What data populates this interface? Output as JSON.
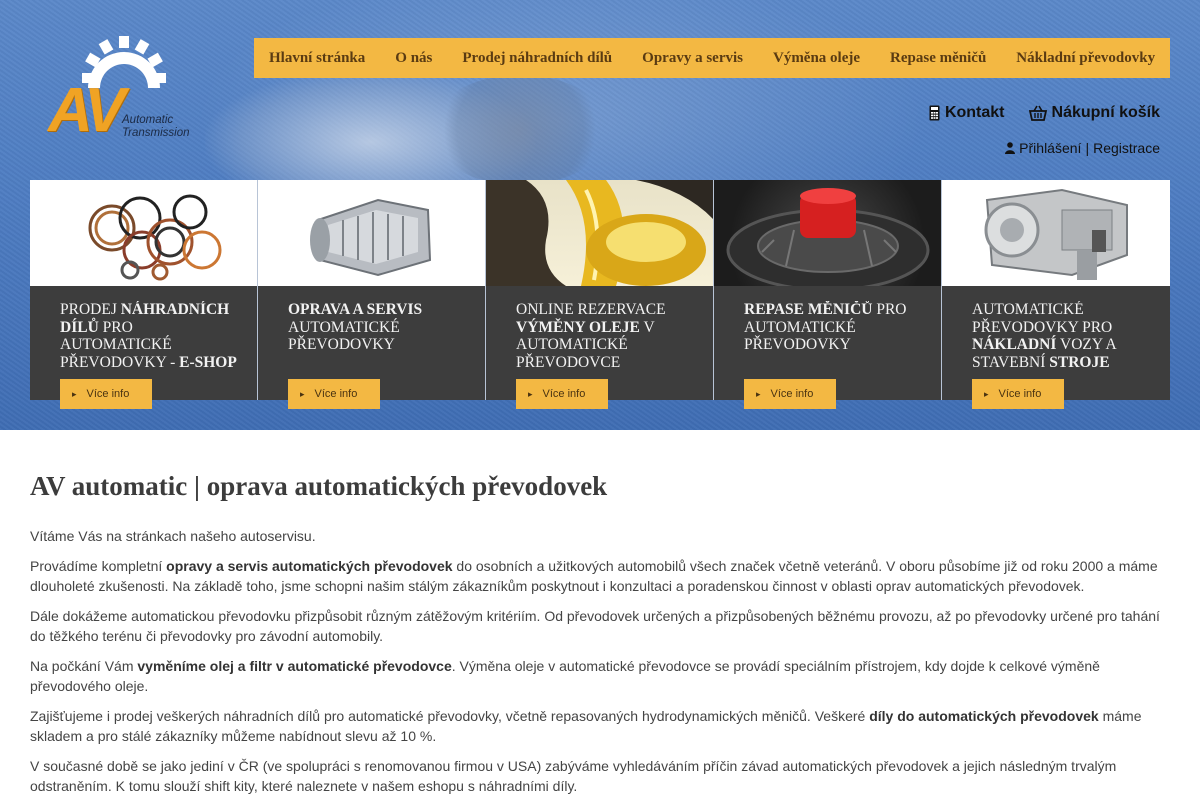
{
  "brand": {
    "logo_letters": "AV",
    "logo_sub_line1": "Automatic",
    "logo_sub_line2": "Transmission",
    "accent_color": "#f3b843",
    "band_color": "#4e7dc2"
  },
  "nav": {
    "items": [
      {
        "label": "Hlavní stránka"
      },
      {
        "label": "O nás"
      },
      {
        "label": "Prodej náhradních dílů"
      },
      {
        "label": "Opravy a servis"
      },
      {
        "label": "Výměna oleje"
      },
      {
        "label": "Repase měničů"
      },
      {
        "label": "Nákladní převodovky"
      }
    ]
  },
  "user": {
    "contact_label": "Kontakt",
    "cart_label": "Nákupní košík",
    "login_label": "Přihlášení",
    "separator": "|",
    "register_label": "Registrace"
  },
  "cards": [
    {
      "image": "transmission-parts-kit",
      "t1": "Prodej ",
      "b1": "náhradních dílů",
      "t2": " pro automatické převodovky - ",
      "b2": "E-shop",
      "button": "Více info"
    },
    {
      "image": "transmission-unit",
      "t1": "",
      "b1": "Oprava a servis",
      "t2": " automatické převodovky",
      "b2": "",
      "button": "Více info"
    },
    {
      "image": "oil-pouring",
      "t1": "Online rezervace ",
      "b1": "výměny oleje",
      "t2": " v automatické převodovce",
      "b2": "",
      "button": "Více info"
    },
    {
      "image": "torque-converter",
      "t1": "",
      "b1": "Repase měničů",
      "t2": " pro automatické převodovky",
      "b2": "",
      "button": "Více info"
    },
    {
      "image": "truck-transmission",
      "t1": "Automatické převodovky pro ",
      "b1": "nákladní",
      "t2": " vozy a stavební ",
      "b2": "stroje",
      "button": "Více info"
    }
  ],
  "content": {
    "heading": "AV automatic | oprava automatických převodovek",
    "p1": "Vítáme Vás na stránkach našeho autoservisu.",
    "p2_a": "Provádíme kompletní ",
    "p2_b": "opravy a servis automatických převodovek",
    "p2_c": " do osobních a užitkových automobilů všech značek včetně veteránů. V oboru působíme již od roku 2000 a máme dlouholeté zkušenosti. Na základě toho, jsme schopni našim stálým zákazníkům poskytnout i konzultaci a poradenskou činnost v oblasti oprav automatických převodovek.",
    "p3": "Dále dokážeme automatickou převodovku přizpůsobit různým zátěžovým kritériím. Od převodovek určených a přizpůsobených běžnému provozu, až po převodovky určené pro tahání do těžkého terénu či převodovky pro závodní automobily.",
    "p4_a": "Na počkání Vám ",
    "p4_b": "vyměníme olej a filtr v automatické převodovce",
    "p4_c": ". Výměna oleje v automatické převodovce se provádí speciálním přístrojem, kdy dojde k celkové výměně převodového oleje.",
    "p5_a": "Zajišťujeme i prodej veškerých náhradních dílů pro automatické převodovky, včetně repasovaných hydrodynamických měničů. Veškeré ",
    "p5_b": "díly do automatických převodovek",
    "p5_c": " máme skladem a pro stálé zákazníky můžeme nabídnout slevu až 10 %.",
    "p6": "V současné době se jako jediní v ČR (ve spolupráci s renomovanou firmou v USA) zabýváme vyhledáváním příčin závad automatických převodovek a jejich následným trvalým odstraněním. K tomu slouží shift kity, které naleznete v našem eshopu s náhradními díly."
  }
}
